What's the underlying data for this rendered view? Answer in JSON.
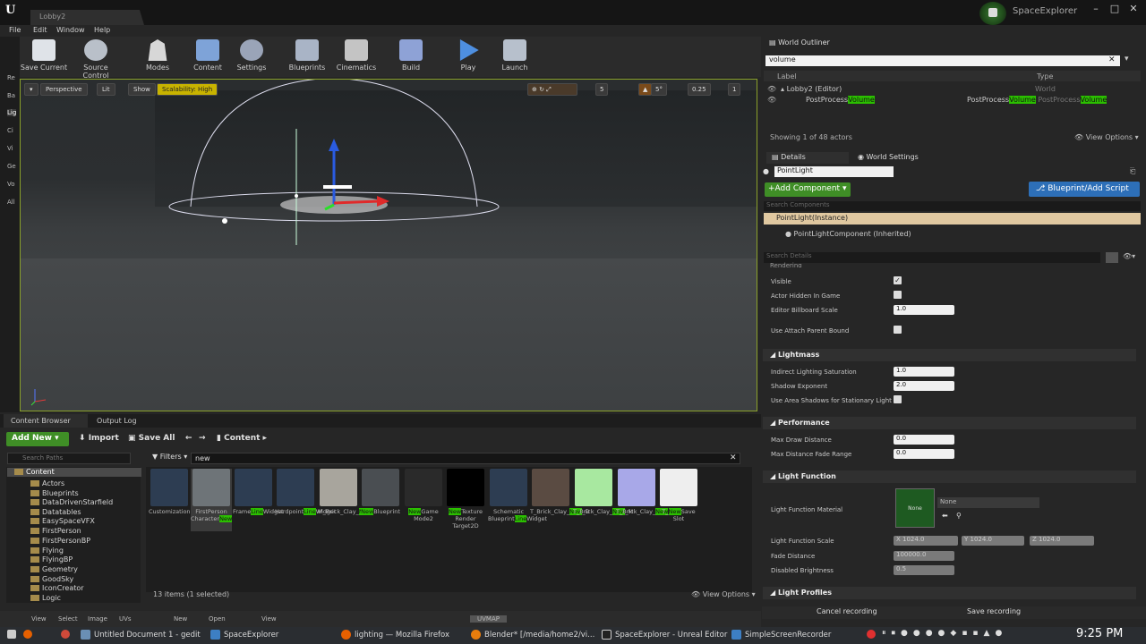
{
  "app": {
    "document_tab": "Lobby2",
    "project_name": "SpaceExplorer"
  },
  "menu": [
    "File",
    "Edit",
    "Window",
    "Help"
  ],
  "toolbar": [
    {
      "label": "Save Current",
      "icon": "save-icon"
    },
    {
      "label": "Source Control",
      "icon": "source-control-icon"
    },
    {
      "label": "Modes",
      "icon": "modes-icon"
    },
    {
      "label": "Content",
      "icon": "content-icon"
    },
    {
      "label": "Settings",
      "icon": "settings-icon"
    },
    {
      "label": "Blueprints",
      "icon": "blueprints-icon"
    },
    {
      "label": "Cinematics",
      "icon": "cinematics-icon"
    },
    {
      "label": "Build",
      "icon": "build-icon"
    },
    {
      "label": "Play",
      "icon": "play-icon"
    },
    {
      "label": "Launch",
      "icon": "launch-icon"
    }
  ],
  "left_strip": [
    "Re",
    "Ba",
    "Lig",
    "Ci",
    "Vi",
    "Ge",
    "Vo",
    "All"
  ],
  "viewport": {
    "perspective": "Perspective",
    "lit": "Lit",
    "show": "Show",
    "scalability": "Scalability: High",
    "grid_snap": "5",
    "rotation_snap": "5°",
    "scale_snap": "0.25",
    "camera_speed": "1"
  },
  "content_browser": {
    "tab_label": "Content Browser",
    "output_tab_label": "Output Log",
    "add_new": "Add New",
    "import": "Import",
    "save_all": "Save All",
    "path": "Content",
    "search_paths_placeholder": "Search Paths",
    "filters": "Filters",
    "search_value": "new",
    "status": "13 items (1 selected)",
    "view_options": "View Options",
    "tree_root": "Content",
    "tree": [
      "Actors",
      "Blueprints",
      "DataDrivenStarfield",
      "Datatables",
      "EasySpaceVFX",
      "FirstPerson",
      "FirstPersonBP",
      "Flying",
      "FlyingBP",
      "Geometry",
      "GoodSky",
      "IconCreator",
      "Logic"
    ],
    "assets": [
      {
        "pre": "Customization",
        "hl": "Line",
        "post": "Widget",
        "thumb": "#2d3d52"
      },
      {
        "pre": "FirstPerson Character",
        "hl": "New",
        "post": "",
        "thumb": "#6e7478"
      },
      {
        "pre": "Frame",
        "hl": "Line",
        "post": "Widget",
        "thumb": "#2d3d52"
      },
      {
        "pre": "Hardpoint",
        "hl": "Line",
        "post": "Widget",
        "thumb": "#2d3d52"
      },
      {
        "pre": "M_Brick_Clay_",
        "hl": "New",
        "post": "",
        "thumb": "#a8a59d"
      },
      {
        "pre": "",
        "hl": "New",
        "post": "Blueprint",
        "thumb": "#4a4e52"
      },
      {
        "pre": "",
        "hl": "New",
        "post": "Game Mode2",
        "thumb": "#2a2a2a"
      },
      {
        "pre": "",
        "hl": "New",
        "post": "Texture Render Target2D",
        "thumb": "#000000"
      },
      {
        "pre": "Schematic Blueprint",
        "hl": "Line",
        "post": "Widget",
        "thumb": "#2d3d52"
      },
      {
        "pre": "T_Brick_Clay_",
        "hl": "New",
        "post": "_D",
        "thumb": "#5a4b42"
      },
      {
        "pre": "T_Brick_Clay_",
        "hl": "New",
        "post": "_M",
        "thumb": "#a8e8a0"
      },
      {
        "pre": "T_Brick_Clay_",
        "hl": "New",
        "post": "_N",
        "thumb": "#a8a8e8"
      },
      {
        "pre": "T_",
        "hl": "New",
        "post": "Save Slot",
        "thumb": "#eeeeee"
      }
    ]
  },
  "outliner": {
    "tab_label": "World Outliner",
    "search_value": "volume",
    "col_label": "Label",
    "col_type": "Type",
    "rows": [
      {
        "label": "Lobby2 (Editor)",
        "type": "World"
      },
      {
        "label_pre": "PostProcess",
        "label_hl": "Volume",
        "type_pre": "PostProcess",
        "type_hl": "Volume",
        "type_pre2": "PostProcess",
        "type_hl2": "Volume"
      }
    ],
    "footer": "Showing 1 of 48 actors",
    "view_options": "View Options"
  },
  "details": {
    "tab_label": "Details",
    "world_settings_tab": "World Settings",
    "actor_name": "PointLight",
    "add_component": "+Add Component",
    "blueprint_script": "Blueprint/Add Script",
    "search_components_placeholder": "Search Components",
    "component_instance": "PointLight(Instance)",
    "component_child": "PointLightComponent (Inherited)",
    "search_details_placeholder": "Search Details",
    "rendering_section": "Rendering",
    "visible": "Visible",
    "actor_hidden": "Actor Hidden In Game",
    "billboard_scale_label": "Editor Billboard Scale",
    "billboard_scale": "1.0",
    "attach_parent": "Use Attach Parent Bound",
    "lightmass_section": "Lightmass",
    "indirect_label": "Indirect Lighting Saturation",
    "indirect_value": "1.0",
    "shadow_exp_label": "Shadow Exponent",
    "shadow_exp_value": "2.0",
    "area_shadows_label": "Use Area Shadows for Stationary Light",
    "performance_section": "Performance",
    "max_draw_label": "Max Draw Distance",
    "max_draw_value": "0.0",
    "max_fade_label": "Max Distance Fade Range",
    "max_fade_value": "0.0",
    "light_function_section": "Light Function",
    "lf_material_label": "Light Function Material",
    "lf_material_thumb": "None",
    "lf_material_value": "None",
    "lf_scale_label": "Light Function Scale",
    "lf_scale_x": "X 1024.0",
    "lf_scale_y": "Y 1024.0",
    "lf_scale_z": "Z 1024.0",
    "fade_dist_label": "Fade Distance",
    "fade_dist_value": "100000.0",
    "disabled_bright_label": "Disabled Brightness",
    "disabled_bright_value": "0.5",
    "light_profiles_section": "Light Profiles"
  },
  "recording": {
    "cancel": "Cancel recording",
    "save": "Save recording"
  },
  "uv_bar": {
    "view": "View",
    "select": "Select",
    "image": "Image",
    "uvs": "UVs",
    "new": "New",
    "open": "Open",
    "view2": "View",
    "uvmap": "UVMAP"
  },
  "taskbar": {
    "items": [
      {
        "label": "Untitled Document 1 - gedit",
        "color": "#6a8fb5"
      },
      {
        "label": "SpaceExplorer",
        "color": "#3d7fc4"
      },
      {
        "label": "lighting — Mozilla Firefox",
        "color": "#e66000"
      },
      {
        "label": "Blender* [/media/home2/vi...",
        "color": "#e87d0d"
      },
      {
        "label": "SpaceExplorer - Unreal Editor",
        "color": "#333333"
      },
      {
        "label": "SimpleScreenRecorder",
        "color": "#3d7fc4"
      }
    ],
    "clock": "9:25 PM"
  }
}
